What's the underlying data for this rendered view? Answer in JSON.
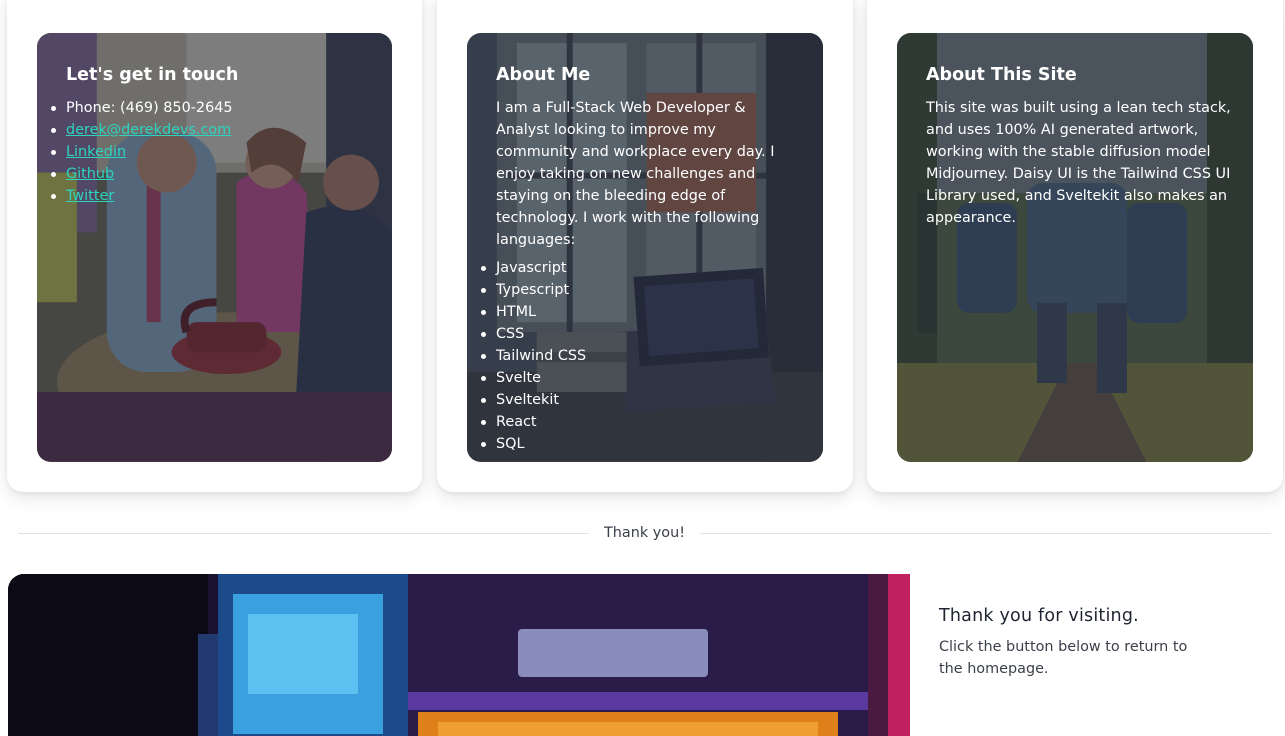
{
  "contact_card": {
    "title": "Let's get in touch",
    "items": [
      {
        "text": "Phone: (469) 850-2645",
        "link": false
      },
      {
        "text": "derek@derekdevs.com",
        "link": true
      },
      {
        "text": "Linkedin",
        "link": true
      },
      {
        "text": "Github",
        "link": true
      },
      {
        "text": "Twitter",
        "link": true
      }
    ]
  },
  "about_me_card": {
    "title": "About Me",
    "paragraph": "I am a Full-Stack Web Developer & Analyst looking to improve my community and workplace every day. I enjoy taking on new challenges and staying on the bleeding edge of technology. I work with the following languages:",
    "languages": [
      "Javascript",
      "Typescript",
      "HTML",
      "CSS",
      "Tailwind CSS",
      "Svelte",
      "Sveltekit",
      "React",
      "SQL"
    ]
  },
  "about_site_card": {
    "title": "About This Site",
    "paragraph": "This site was built using a lean tech stack, and uses 100% AI generated artwork, working with the stable diffusion model Midjourney. Daisy UI is the Tailwind CSS UI Library used, and Sveltekit also makes an appearance."
  },
  "divider": {
    "text": "Thank you!"
  },
  "thanks": {
    "title": "Thank you for visiting.",
    "text": "Click the button below to return to the homepage."
  },
  "colors": {
    "link": "#2dd4bf",
    "overlay": "#24283a",
    "card_bg": "#ffffff",
    "body_text": "#3b3f4a"
  }
}
